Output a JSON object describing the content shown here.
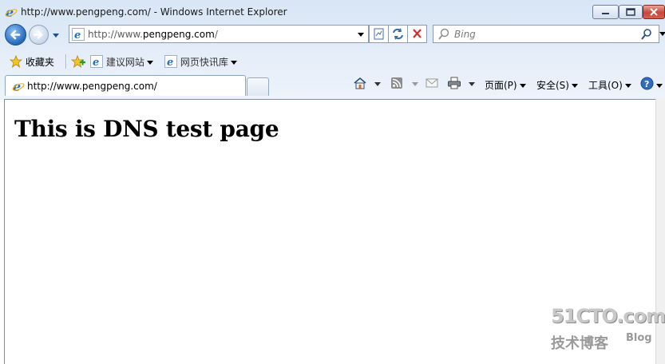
{
  "window": {
    "title": "http://www.pengpeng.com/ - Windows Internet Explorer"
  },
  "address": {
    "prefix": "http://www.",
    "domain": "pengpeng.com",
    "suffix": "/"
  },
  "search": {
    "placeholder": "Bing"
  },
  "favorites_bar": {
    "favorites_label": "收藏夹",
    "suggested_sites_label": "建议网站",
    "web_slice_gallery_label": "网页快讯库"
  },
  "tab": {
    "title": "http://www.pengpeng.com/"
  },
  "command_bar": {
    "page_label": "页面(P)",
    "safety_label": "安全(S)",
    "tools_label": "工具(O)"
  },
  "page": {
    "heading": "This is DNS test page"
  },
  "watermark": {
    "brand": "51CTO.com",
    "tagline": "技术博客",
    "blog": "Blog"
  },
  "colors": {
    "chrome_background": "#dde9f7",
    "ie_blue": "#1f6fc7",
    "close_red": "#c8473a"
  }
}
